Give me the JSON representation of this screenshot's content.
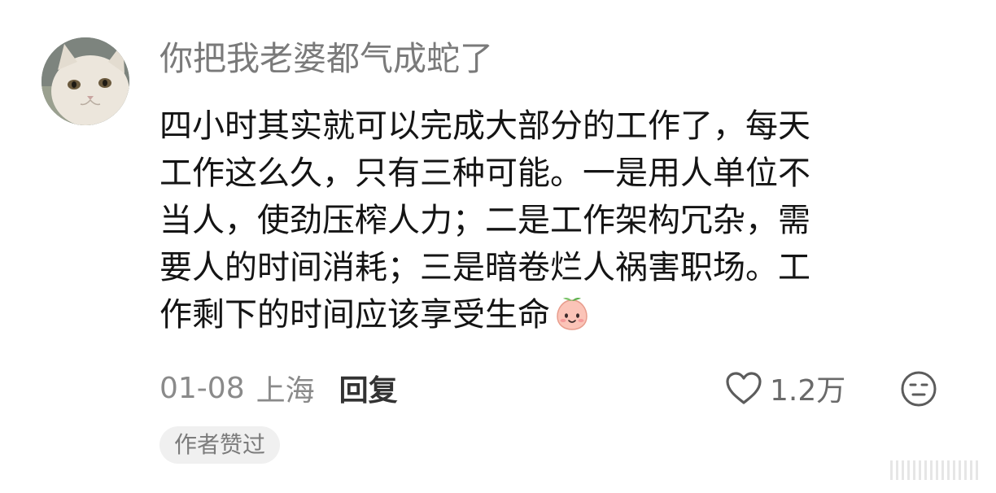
{
  "comment": {
    "username": "你把我老婆都气成蛇了",
    "lines": [
      "四小时其实就可以完成大部分的工作了，每天",
      "工作这么久，只有三种可能。一是用人单位不",
      "当人，使劲压榨人力；二是工作架构冗杂，需",
      "要人的时间消耗；三是暗卷烂人祸害职场。工",
      "作剩下的时间应该享受生命"
    ],
    "date": "01-08",
    "location": "上海",
    "reply_label": "回复",
    "like_count": "1.2万",
    "author_badge": "作者赞过"
  },
  "icons": {
    "avatar": "cat-avatar",
    "emoji": "smiling-peach-emoji",
    "like": "heart-outline-icon",
    "dislike": "neutral-face-icon"
  },
  "colors": {
    "username": "#7a7a7a",
    "text": "#141414",
    "meta": "#8a8a8a",
    "badge_bg": "#f0f0f0"
  }
}
